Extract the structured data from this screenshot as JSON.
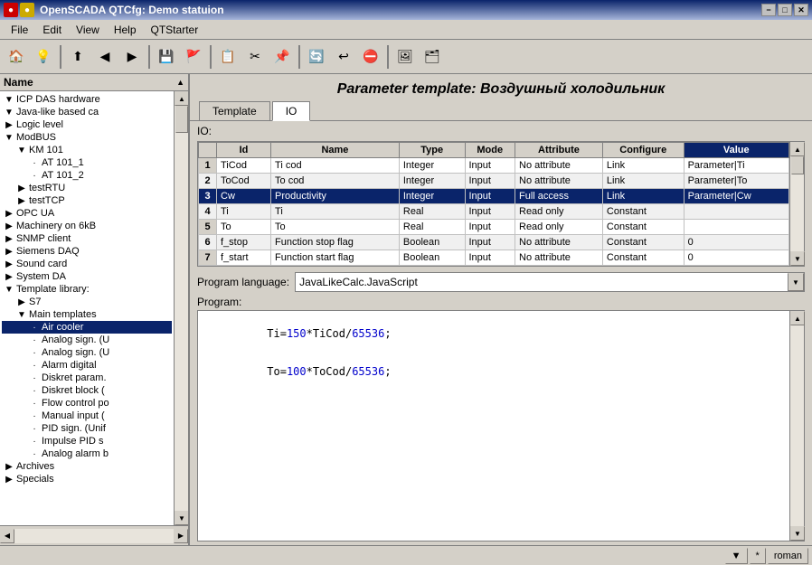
{
  "titlebar": {
    "title": "OpenSCADA QTCfg: Demo statuion",
    "icons": [
      "red",
      "yellow"
    ],
    "win_buttons": [
      "−",
      "□",
      "✕"
    ]
  },
  "menubar": {
    "items": [
      "File",
      "Edit",
      "View",
      "Help",
      "QTStarter"
    ]
  },
  "toolbar": {
    "buttons": [
      {
        "name": "home",
        "icon": "🏠"
      },
      {
        "name": "info",
        "icon": "💡"
      },
      {
        "name": "up",
        "icon": "⬆"
      },
      {
        "name": "back",
        "icon": "◀"
      },
      {
        "name": "forward",
        "icon": "▶"
      },
      {
        "name": "save",
        "icon": "💾"
      },
      {
        "name": "flag",
        "icon": "🚩"
      },
      {
        "name": "copy",
        "icon": "📋"
      },
      {
        "name": "cut",
        "icon": "✂"
      },
      {
        "name": "paste",
        "icon": "📌"
      },
      {
        "name": "refresh",
        "icon": "🔄"
      },
      {
        "name": "reload",
        "icon": "↩"
      },
      {
        "name": "stop",
        "icon": "⛔"
      },
      {
        "name": "img1",
        "icon": "🖼"
      },
      {
        "name": "img2",
        "icon": "🗂"
      }
    ]
  },
  "sidebar": {
    "header": "Name",
    "tree": [
      {
        "level": 0,
        "expanded": true,
        "icon": "💻",
        "label": "ICP DAS hardware",
        "selected": false
      },
      {
        "level": 0,
        "expanded": true,
        "icon": "☕",
        "label": "Java-like based ca",
        "selected": false
      },
      {
        "level": 0,
        "expanded": false,
        "icon": "⚡",
        "label": "Logic level",
        "selected": false
      },
      {
        "level": 0,
        "expanded": true,
        "icon": "🔌",
        "label": "ModBUS",
        "selected": false
      },
      {
        "level": 1,
        "expanded": true,
        "icon": "📦",
        "label": "KM 101",
        "selected": false
      },
      {
        "level": 2,
        "expanded": false,
        "icon": "📄",
        "label": "AT 101_1",
        "selected": false
      },
      {
        "level": 2,
        "expanded": false,
        "icon": "📄",
        "label": "AT 101_2",
        "selected": false
      },
      {
        "level": 1,
        "expanded": false,
        "icon": "📄",
        "label": "testRTU",
        "selected": false
      },
      {
        "level": 1,
        "expanded": false,
        "icon": "📄",
        "label": "testTCP",
        "selected": false
      },
      {
        "level": 0,
        "expanded": false,
        "icon": "🖥",
        "label": "OPC UA",
        "selected": false
      },
      {
        "level": 0,
        "expanded": false,
        "icon": "📡",
        "label": "Machinery on 6kB",
        "selected": false
      },
      {
        "level": 0,
        "expanded": false,
        "icon": "🌐",
        "label": "SNMP client",
        "selected": false
      },
      {
        "level": 0,
        "expanded": false,
        "icon": "📶",
        "label": "Siemens DAQ",
        "selected": false
      },
      {
        "level": 0,
        "expanded": false,
        "icon": "🔊",
        "label": "Sound card",
        "selected": false
      },
      {
        "level": 0,
        "expanded": false,
        "icon": "🖥",
        "label": "System DA",
        "selected": false
      },
      {
        "level": 0,
        "expanded": true,
        "icon": "📚",
        "label": "Template library:",
        "selected": false
      },
      {
        "level": 1,
        "expanded": false,
        "icon": "📁",
        "label": "S7",
        "selected": false
      },
      {
        "level": 1,
        "expanded": true,
        "icon": "📁",
        "label": "Main templates",
        "selected": false
      },
      {
        "level": 2,
        "expanded": false,
        "icon": "📄",
        "label": "Air cooler",
        "selected": true
      },
      {
        "level": 2,
        "expanded": false,
        "icon": "📄",
        "label": "Analog sign. (U",
        "selected": false
      },
      {
        "level": 2,
        "expanded": false,
        "icon": "📄",
        "label": "Analog sign. (U",
        "selected": false
      },
      {
        "level": 2,
        "expanded": false,
        "icon": "📄",
        "label": "Alarm digital",
        "selected": false
      },
      {
        "level": 2,
        "expanded": false,
        "icon": "📄",
        "label": "Diskret param.",
        "selected": false
      },
      {
        "level": 2,
        "expanded": false,
        "icon": "📄",
        "label": "Diskret block (",
        "selected": false
      },
      {
        "level": 2,
        "expanded": false,
        "icon": "📄",
        "label": "Flow control po",
        "selected": false
      },
      {
        "level": 2,
        "expanded": false,
        "icon": "📄",
        "label": "Manual input (",
        "selected": false
      },
      {
        "level": 2,
        "expanded": false,
        "icon": "📄",
        "label": "PID sign. (Unif",
        "selected": false
      },
      {
        "level": 2,
        "expanded": false,
        "icon": "📄",
        "label": "Impulse PID s",
        "selected": false
      },
      {
        "level": 2,
        "expanded": false,
        "icon": "📄",
        "label": "Analog alarm b",
        "selected": false
      },
      {
        "level": 0,
        "expanded": false,
        "icon": "🗄",
        "label": "Archives",
        "selected": false
      },
      {
        "level": 0,
        "expanded": false,
        "icon": "⭐",
        "label": "Specials",
        "selected": false
      }
    ]
  },
  "content": {
    "header": "Parameter template: Воздушный холодильник",
    "tabs": [
      {
        "label": "Template",
        "active": false
      },
      {
        "label": "IO",
        "active": true
      }
    ],
    "io_label": "IO:",
    "table": {
      "columns": [
        "Id",
        "Name",
        "Type",
        "Mode",
        "Attribute",
        "Configure",
        "Value"
      ],
      "rows": [
        {
          "num": 1,
          "id": "TiCod",
          "name": "Ti cod",
          "type": "Integer",
          "mode": "Input",
          "attribute": "No attribute",
          "configure": "Link",
          "value": "Parameter|Ti"
        },
        {
          "num": 2,
          "id": "ToCod",
          "name": "To cod",
          "type": "Integer",
          "mode": "Input",
          "attribute": "No attribute",
          "configure": "Link",
          "value": "Parameter|To"
        },
        {
          "num": 3,
          "id": "Cw",
          "name": "Productivity",
          "type": "Integer",
          "mode": "Input",
          "attribute": "Full access",
          "configure": "Link",
          "value": "Parameter|Cw",
          "selected": true
        },
        {
          "num": 4,
          "id": "Ti",
          "name": "Ti",
          "type": "Real",
          "mode": "Input",
          "attribute": "Read only",
          "configure": "Constant",
          "value": ""
        },
        {
          "num": 5,
          "id": "To",
          "name": "To",
          "type": "Real",
          "mode": "Input",
          "attribute": "Read only",
          "configure": "Constant",
          "value": ""
        },
        {
          "num": 6,
          "id": "f_stop",
          "name": "Function stop flag",
          "type": "Boolean",
          "mode": "Input",
          "attribute": "No attribute",
          "configure": "Constant",
          "value": "0"
        },
        {
          "num": 7,
          "id": "f_start",
          "name": "Function start flag",
          "type": "Boolean",
          "mode": "Input",
          "attribute": "No attribute",
          "configure": "Constant",
          "value": "0"
        }
      ]
    },
    "prog_lang_label": "Program language:",
    "prog_lang_value": "JavaLikeCalc.JavaScript",
    "prog_label": "Program:",
    "prog_code": [
      {
        "type": "normal",
        "text": "Ti="
      },
      {
        "type": "number",
        "text": "150"
      },
      {
        "type": "normal",
        "text": "*TiCod/"
      },
      {
        "type": "number",
        "text": "65536"
      },
      {
        "type": "normal",
        "text": ";"
      },
      {
        "type": "newline"
      },
      {
        "type": "normal",
        "text": "To="
      },
      {
        "type": "number",
        "text": "100"
      },
      {
        "type": "normal",
        "text": "*ToCod/"
      },
      {
        "type": "number",
        "text": "65536"
      },
      {
        "type": "normal",
        "text": ";"
      }
    ]
  },
  "statusbar": {
    "buttons": [
      "▼",
      "*",
      "roman"
    ]
  }
}
